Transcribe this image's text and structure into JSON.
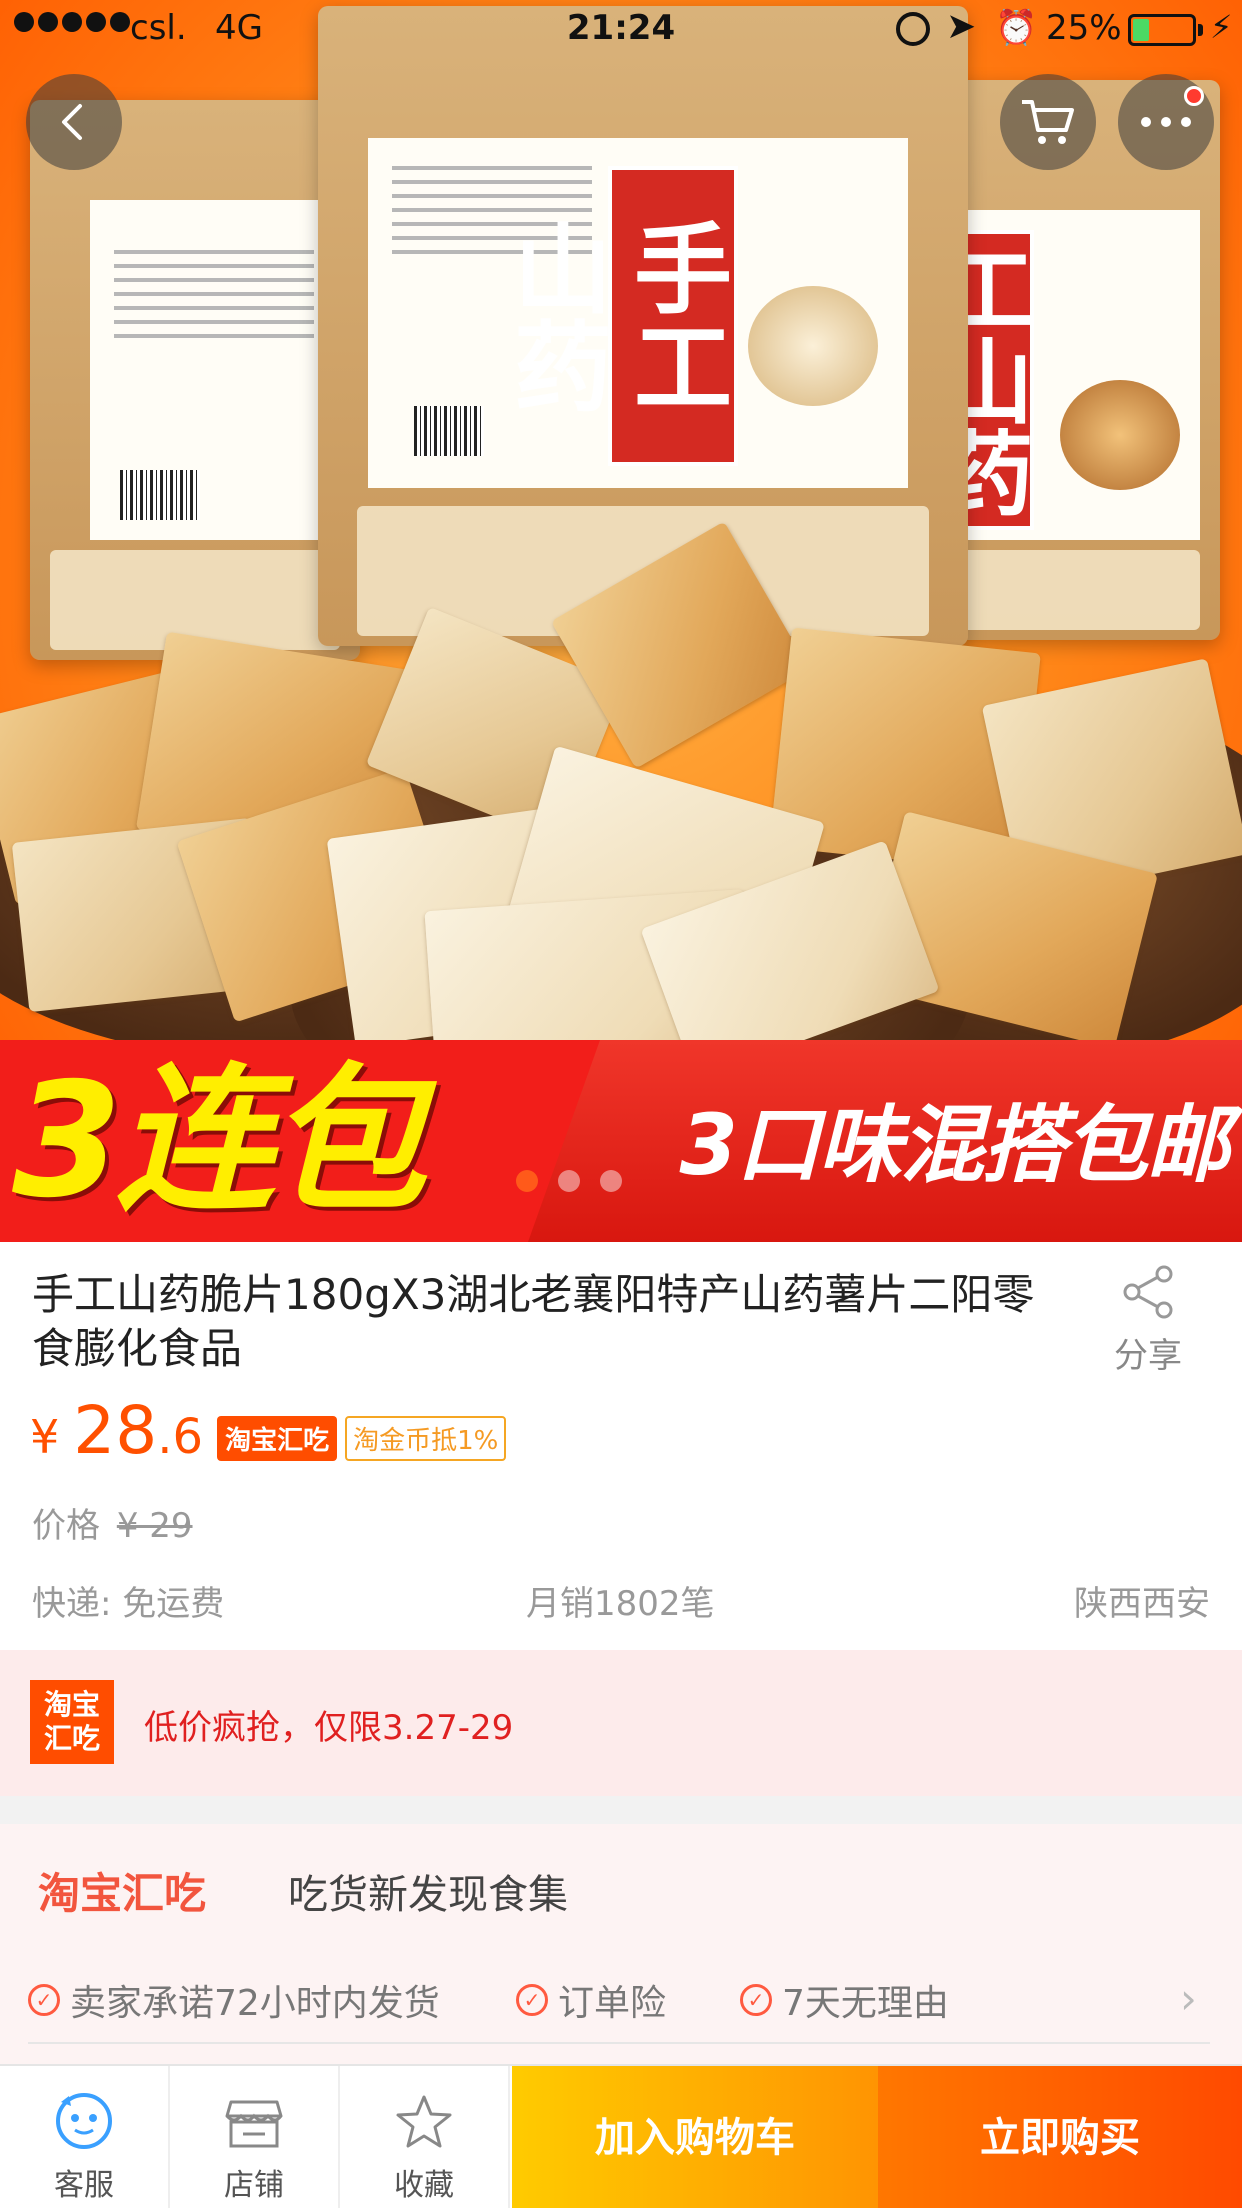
{
  "status": {
    "carrier": "csl.",
    "network": "4G",
    "time": "21:24",
    "battery_text": "25%",
    "battery_level": 0.25
  },
  "hero": {
    "bag_center_text": "手工山药",
    "bag_right_text": "工山药",
    "banner_left": "3连包",
    "banner_right": "3口味混搭包邮",
    "slides_total": 3,
    "active_slide": 0
  },
  "product": {
    "title": "手工山药脆片180gX3湖北老襄阳特产山药薯片二阳零食膨化食品",
    "share_label": "分享",
    "price_symbol": "¥",
    "price_int": "28",
    "price_dec": ".6",
    "tag_channel": "淘宝汇吃",
    "tag_coin": "淘金币抵1%",
    "orig_label": "价格",
    "orig_price": "¥ 29",
    "shipping": "快递: 免运费",
    "monthly_sales": "月销1802笔",
    "location": "陕西西安"
  },
  "promo": {
    "logo_line1": "淘宝",
    "logo_line2": "汇吃",
    "text": "低价疯抢，仅限3.27-29"
  },
  "channel": {
    "brand": "淘宝汇吃",
    "slogan": "吃货新发现食集",
    "guarantees": [
      "卖家承诺72小时内发货",
      "订单险",
      "7天无理由"
    ]
  },
  "bottom": {
    "service": "客服",
    "shop": "店铺",
    "favorite": "收藏",
    "add_cart": "加入购物车",
    "buy_now": "立即购买"
  },
  "colors": {
    "accent": "#ff5000",
    "cart_gradient": "#ffcb00",
    "buy_gradient": "#ff4a00",
    "promo_bg": "#fdebeb"
  },
  "icons": {
    "back": "chevron-left-icon",
    "cart": "cart-icon",
    "more": "more-icon",
    "share": "share-icon",
    "service": "chat-icon",
    "shop": "shop-icon",
    "favorite": "star-icon"
  }
}
